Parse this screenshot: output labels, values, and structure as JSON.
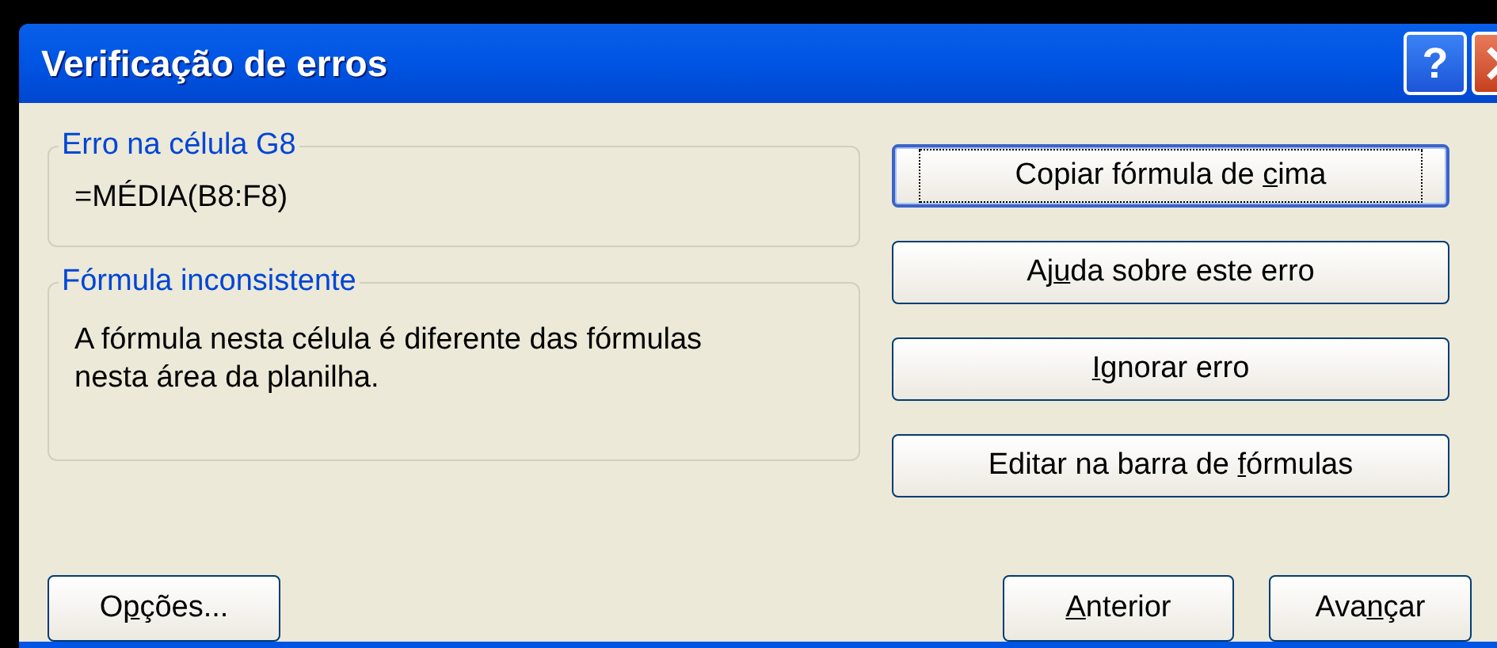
{
  "window": {
    "title": "Verificação de erros",
    "help_button": "?"
  },
  "error_group": {
    "legend": "Erro na célula G8",
    "formula": "=MÉDIA(B8:F8)"
  },
  "description_group": {
    "legend": "Fórmula inconsistente",
    "text": "A fórmula nesta célula é diferente das fórmulas nesta área da planilha."
  },
  "action_buttons": [
    {
      "before": "Copiar fórmula de ",
      "key": "c",
      "after": "ima",
      "focused": true
    },
    {
      "before": "Aj",
      "key": "u",
      "after": "da sobre este erro",
      "focused": false
    },
    {
      "key": "I",
      "after": "gnorar erro",
      "focused": false
    },
    {
      "before": "Editar na barra de ",
      "key": "f",
      "after": "órmulas",
      "focused": false
    }
  ],
  "footer_buttons": [
    {
      "before": "O",
      "key": "p",
      "after": "ções...",
      "focused": false
    },
    {
      "key": "A",
      "after": "nterior",
      "focused": false
    },
    {
      "before": "Ava",
      "key": "n",
      "after": "çar",
      "focused": false
    }
  ]
}
